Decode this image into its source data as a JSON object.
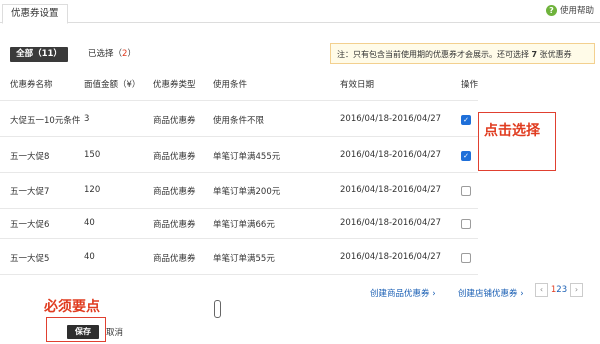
{
  "tabbar": {
    "tab_label": "优惠券设置",
    "help_label": "使用帮助",
    "help_icon": "question-circle-icon"
  },
  "filter": {
    "all_label": "全部（11）",
    "selected_label": "已选择（",
    "selected_count": "2",
    "selected_suffix": "）"
  },
  "notice": {
    "text_before": "注：只有包含当前使用期的优惠券才会展示。还可选择 ",
    "remaining": "7",
    "text_after": " 张优惠券"
  },
  "table": {
    "headers": [
      "优惠券名称",
      "面值金额（¥）",
      "优惠券类型",
      "使用条件",
      "有效日期",
      "操作"
    ],
    "rows": [
      {
        "name": "大促五一10元条件",
        "amount": "3",
        "type": "商品优惠券",
        "condition": "使用条件不限",
        "date": "2016/04/18-2016/04/27",
        "checked": true
      },
      {
        "name": "五一大促8",
        "amount": "150",
        "type": "商品优惠券",
        "condition": "单笔订单满455元",
        "date": "2016/04/18-2016/04/27",
        "checked": true
      },
      {
        "name": "五一大促7",
        "amount": "120",
        "type": "商品优惠券",
        "condition": "单笔订单满200元",
        "date": "2016/04/18-2016/04/27",
        "checked": false
      },
      {
        "name": "五一大促6",
        "amount": "40",
        "type": "商品优惠券",
        "condition": "单笔订单满66元",
        "date": "2016/04/18-2016/04/27",
        "checked": false
      },
      {
        "name": "五一大促5",
        "amount": "40",
        "type": "商品优惠券",
        "condition": "单笔订单满55元",
        "date": "2016/04/18-2016/04/27",
        "checked": false
      }
    ]
  },
  "annotations": {
    "click_select": "点击选择",
    "must_click": "必须要点"
  },
  "links": {
    "create_product_coupon": "创建商品优惠券 ›",
    "create_shop_coupon": "创建店铺优惠券 ›"
  },
  "pager": {
    "prev": "‹",
    "pages": [
      "1",
      "2",
      "3"
    ],
    "current": "1",
    "next": "›"
  },
  "actions": {
    "save_label": "保存",
    "cancel_label": "取消"
  },
  "colors": {
    "accent_red": "#e03c20",
    "link_blue": "#1a5fb4",
    "check_blue": "#1e6fd9",
    "dark_button": "#2e2e2e"
  }
}
